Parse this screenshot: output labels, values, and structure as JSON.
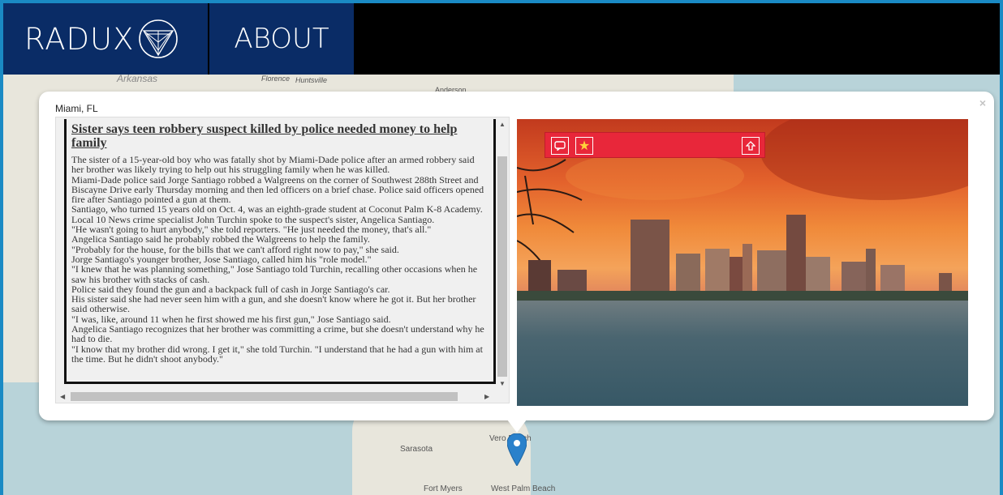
{
  "nav": {
    "logo_text": "RADUX",
    "about_label": "ABOUT"
  },
  "map": {
    "labels": {
      "arkansas": "Arkansas",
      "florence": "Florence",
      "huntsville": "Huntsville",
      "anderson": "Anderson",
      "sarasota": "Sarasota",
      "vero_beach": "Vero Beach",
      "fort_myers": "Fort Myers",
      "west_palm_beach": "West Palm Beach"
    }
  },
  "popup": {
    "close_label": "×",
    "location": "Miami, FL",
    "article": {
      "headline": "Sister says teen robbery suspect killed by police needed money to help family",
      "paragraphs": [
        "The sister of a 15-year-old boy who was fatally shot by Miami-Dade police after an armed robbery said her brother was likely trying to help out his struggling family when he was killed.",
        "Miami-Dade police said Jorge Santiago robbed a Walgreens on the corner of Southwest 288th Street and Biscayne Drive early Thursday morning and then led officers on a brief chase. Police said officers opened fire after Santiago pointed a gun at them.",
        "Santiago, who turned 15 years old on Oct. 4, was an eighth-grade student at Coconut Palm K-8 Academy.",
        "Local 10 News crime specialist John Turchin spoke to the suspect's sister, Angelica Santiago.",
        "\"He wasn't going to hurt anybody,\" she told reporters. \"He just needed the money, that's all.\"",
        "Angelica Santiago said he probably robbed the Walgreens to help the family.",
        "\"Probably for the house, for the bills that we can't afford right now to pay,\" she said.",
        "Jorge Santiago's younger brother, Jose Santiago, called him his \"role model.\"",
        "\"I knew that he was planning something,\" Jose Santiago told Turchin, recalling other occasions when he saw his brother with stacks of cash.",
        "Police said they found the gun and a backpack full of cash in Jorge Santiago's car.",
        "His sister said she had never seen him with a gun, and she doesn't know where he got it. But her brother said otherwise.",
        "\"I was, like, around 11 when he first showed me his first gun,\" Jose Santiago said.",
        "Angelica Santiago recognizes that her brother was committing a crime, but she doesn't understand why he had to die.",
        "\"I know that my brother did wrong. I get it,\" she told Turchin. \"I understand that he had a gun with him at the time. But he didn't shoot anybody.\""
      ]
    },
    "toolbar": {
      "comment_icon": "comment-icon",
      "star_icon": "star-icon",
      "share_icon": "share-up-icon"
    }
  },
  "colors": {
    "nav_bg": "#0a2c66",
    "toolbar_red": "#e8273a",
    "marker_blue": "#2a81cb"
  }
}
